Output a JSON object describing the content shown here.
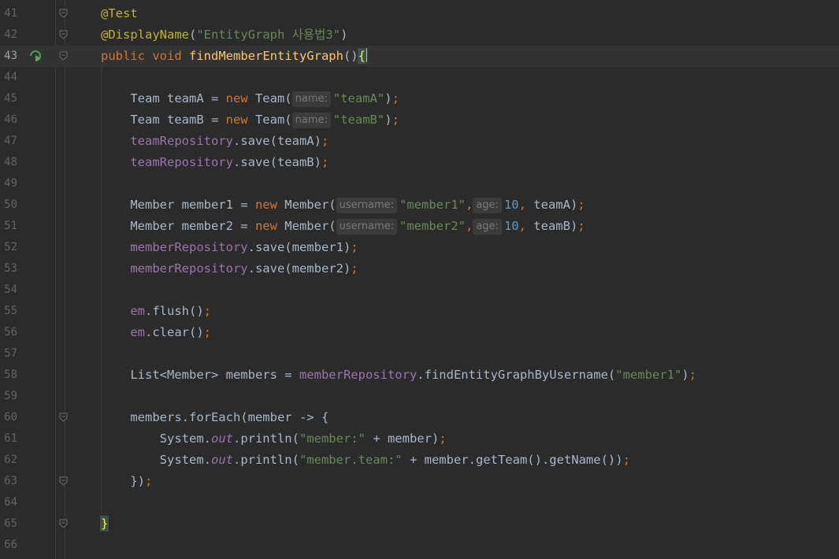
{
  "editor": {
    "current_line": 43,
    "lines": [
      {
        "n": "41",
        "tokens": [
          {
            "t": "@Test",
            "c": "ann"
          }
        ]
      },
      {
        "n": "42",
        "tokens": [
          {
            "t": "@DisplayName",
            "c": "ann"
          },
          {
            "t": "(",
            "c": ""
          },
          {
            "t": "\"EntityGraph 사용법3\"",
            "c": "str"
          },
          {
            "t": ")",
            "c": ""
          }
        ]
      },
      {
        "n": "43",
        "tokens": [
          {
            "t": "public ",
            "c": "kw"
          },
          {
            "t": "void ",
            "c": "kw"
          },
          {
            "t": "findMemberEntityGraph",
            "c": "fn"
          },
          {
            "t": "()",
            "c": ""
          },
          {
            "t": "{",
            "c": "brace-hl"
          }
        ]
      },
      {
        "n": "44",
        "tokens": []
      },
      {
        "n": "45",
        "tokens": [
          {
            "t": "    Team teamA = ",
            "c": ""
          },
          {
            "t": "new ",
            "c": "kw"
          },
          {
            "t": "Team(",
            "c": ""
          },
          {
            "t": "name:",
            "c": "hint"
          },
          {
            "t": "\"teamA\"",
            "c": "str"
          },
          {
            "t": ")",
            "c": ""
          },
          {
            "t": ";",
            "c": "kw"
          }
        ]
      },
      {
        "n": "46",
        "tokens": [
          {
            "t": "    Team teamB = ",
            "c": ""
          },
          {
            "t": "new ",
            "c": "kw"
          },
          {
            "t": "Team(",
            "c": ""
          },
          {
            "t": "name:",
            "c": "hint"
          },
          {
            "t": "\"teamB\"",
            "c": "str"
          },
          {
            "t": ")",
            "c": ""
          },
          {
            "t": ";",
            "c": "kw"
          }
        ]
      },
      {
        "n": "47",
        "tokens": [
          {
            "t": "    ",
            "c": ""
          },
          {
            "t": "teamRepository",
            "c": "fld"
          },
          {
            "t": ".save(teamA)",
            "c": ""
          },
          {
            "t": ";",
            "c": "kw"
          }
        ]
      },
      {
        "n": "48",
        "tokens": [
          {
            "t": "    ",
            "c": ""
          },
          {
            "t": "teamRepository",
            "c": "fld"
          },
          {
            "t": ".save(teamB)",
            "c": ""
          },
          {
            "t": ";",
            "c": "kw"
          }
        ]
      },
      {
        "n": "49",
        "tokens": []
      },
      {
        "n": "50",
        "tokens": [
          {
            "t": "    Member member1 = ",
            "c": ""
          },
          {
            "t": "new ",
            "c": "kw"
          },
          {
            "t": "Member(",
            "c": ""
          },
          {
            "t": "username:",
            "c": "hint"
          },
          {
            "t": "\"member1\"",
            "c": "str"
          },
          {
            "t": ",",
            "c": "kw"
          },
          {
            "t": "age:",
            "c": "hint"
          },
          {
            "t": "10",
            "c": "num"
          },
          {
            "t": ", ",
            "c": "kw"
          },
          {
            "t": "teamA)",
            "c": ""
          },
          {
            "t": ";",
            "c": "kw"
          }
        ]
      },
      {
        "n": "51",
        "tokens": [
          {
            "t": "    Member member2 = ",
            "c": ""
          },
          {
            "t": "new ",
            "c": "kw"
          },
          {
            "t": "Member(",
            "c": ""
          },
          {
            "t": "username:",
            "c": "hint"
          },
          {
            "t": "\"member2\"",
            "c": "str"
          },
          {
            "t": ",",
            "c": "kw"
          },
          {
            "t": "age:",
            "c": "hint"
          },
          {
            "t": "10",
            "c": "num"
          },
          {
            "t": ", ",
            "c": "kw"
          },
          {
            "t": "teamB)",
            "c": ""
          },
          {
            "t": ";",
            "c": "kw"
          }
        ]
      },
      {
        "n": "52",
        "tokens": [
          {
            "t": "    ",
            "c": ""
          },
          {
            "t": "memberRepository",
            "c": "fld"
          },
          {
            "t": ".save(member1)",
            "c": ""
          },
          {
            "t": ";",
            "c": "kw"
          }
        ]
      },
      {
        "n": "53",
        "tokens": [
          {
            "t": "    ",
            "c": ""
          },
          {
            "t": "memberRepository",
            "c": "fld"
          },
          {
            "t": ".save(member2)",
            "c": ""
          },
          {
            "t": ";",
            "c": "kw"
          }
        ]
      },
      {
        "n": "54",
        "tokens": []
      },
      {
        "n": "55",
        "tokens": [
          {
            "t": "    ",
            "c": ""
          },
          {
            "t": "em",
            "c": "fld"
          },
          {
            "t": ".flush()",
            "c": ""
          },
          {
            "t": ";",
            "c": "kw"
          }
        ]
      },
      {
        "n": "56",
        "tokens": [
          {
            "t": "    ",
            "c": ""
          },
          {
            "t": "em",
            "c": "fld"
          },
          {
            "t": ".clear()",
            "c": ""
          },
          {
            "t": ";",
            "c": "kw"
          }
        ]
      },
      {
        "n": "57",
        "tokens": []
      },
      {
        "n": "58",
        "tokens": [
          {
            "t": "    List<Member> members = ",
            "c": ""
          },
          {
            "t": "memberRepository",
            "c": "fld"
          },
          {
            "t": ".findEntityGraphByUsername(",
            "c": ""
          },
          {
            "t": "\"member1\"",
            "c": "str"
          },
          {
            "t": ")",
            "c": ""
          },
          {
            "t": ";",
            "c": "kw"
          }
        ]
      },
      {
        "n": "59",
        "tokens": []
      },
      {
        "n": "60",
        "tokens": [
          {
            "t": "    members.forEach(member -> {",
            "c": ""
          }
        ]
      },
      {
        "n": "61",
        "tokens": [
          {
            "t": "        System.",
            "c": ""
          },
          {
            "t": "out",
            "c": "stat"
          },
          {
            "t": ".println(",
            "c": ""
          },
          {
            "t": "\"member:\"",
            "c": "str"
          },
          {
            "t": " + member)",
            "c": ""
          },
          {
            "t": ";",
            "c": "kw"
          }
        ]
      },
      {
        "n": "62",
        "tokens": [
          {
            "t": "        System.",
            "c": ""
          },
          {
            "t": "out",
            "c": "stat"
          },
          {
            "t": ".println(",
            "c": ""
          },
          {
            "t": "\"member.team:\"",
            "c": "str"
          },
          {
            "t": " + member.getTeam().getName())",
            "c": ""
          },
          {
            "t": ";",
            "c": "kw"
          }
        ]
      },
      {
        "n": "63",
        "tokens": [
          {
            "t": "    })",
            "c": ""
          },
          {
            "t": ";",
            "c": "kw"
          }
        ]
      },
      {
        "n": "64",
        "tokens": []
      },
      {
        "n": "65",
        "tokens": [
          {
            "t": "}",
            "c": "brace-hl"
          }
        ]
      },
      {
        "n": "66",
        "tokens": []
      }
    ],
    "fold_markers": [
      "41",
      "42",
      "43",
      "60",
      "63",
      "65"
    ],
    "run_icon_line": "43",
    "colors": {
      "background": "#2b2b2b",
      "keyword": "#cc7832",
      "string": "#6a8759",
      "annotation": "#bbb529",
      "field": "#9876aa",
      "function": "#ffc66d",
      "number": "#6897bb"
    }
  }
}
